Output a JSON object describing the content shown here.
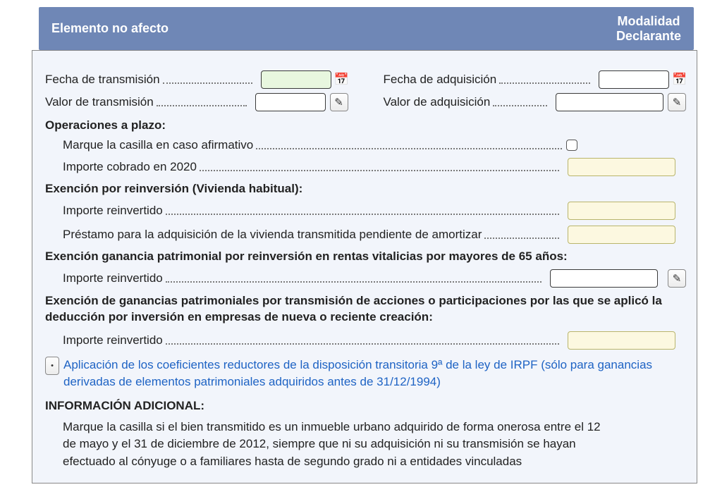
{
  "header": {
    "left": "Elemento no afecto",
    "right_line1": "Modalidad",
    "right_line2": "Declarante"
  },
  "f": {
    "fecha_transmision": "Fecha de transmisión",
    "fecha_adquisicion": "Fecha de adquisición",
    "valor_transmision": "Valor de transmisión",
    "valor_adquisicion": "Valor de adquisición",
    "operaciones_plazo": "Operaciones a plazo:",
    "marque_afirmativo": "Marque la casilla en caso afirmativo",
    "importe_2020": "Importe cobrado en 2020",
    "exencion_reinv": "Exención por reinversión (Vivienda habitual):",
    "importe_reinvertido": "Importe reinvertido",
    "prestamo": "Préstamo para la adquisición de la vivienda transmitida pendiente de amortizar",
    "exencion_65": "Exención ganancia patrimonial por reinversión en rentas vitalicias por mayores de 65 años:",
    "exencion_acciones": "Exención de ganancias patrimoniales por transmisión de acciones o participaciones por las que se aplicó la deducción por inversión en empresas de nueva o reciente creación:",
    "coef_reductores": "Aplicación de los coeficientes reductores de la disposición transitoria 9ª de la ley de IRPF (sólo para ganancias derivadas de elementos patrimoniales adquiridos antes de 31/12/1994)",
    "info_adicional": "INFORMACIÓN ADICIONAL:",
    "info_text": "Marque la casilla si el bien transmitido es un inmueble urbano adquirido de forma onerosa entre el 12 de mayo y el 31 de diciembre de 2012, siempre que ni su adquisición ni su transmisión se hayan efectuado al cónyuge o a familiares hasta de segundo grado ni a entidades vinculadas"
  },
  "icons": {
    "calendar": "📅",
    "pencil": "✎",
    "toggle": "•"
  }
}
